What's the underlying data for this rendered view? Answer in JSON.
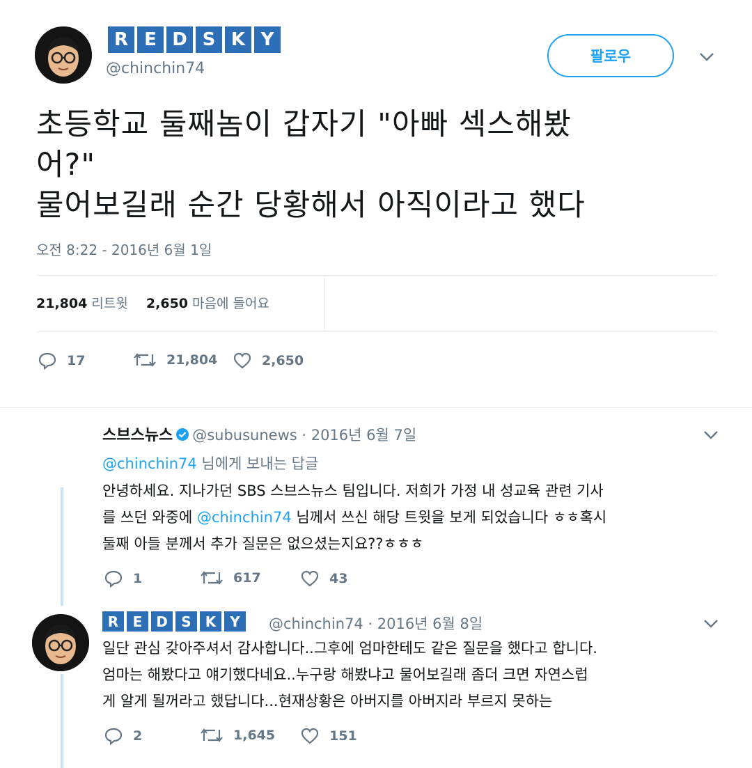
{
  "main_tweet": {
    "display_name_badges": [
      "R",
      "E",
      "D",
      "S",
      "K",
      "Y"
    ],
    "handle": "@chinchin74",
    "follow_label": "팔로우",
    "text_lines": [
      "초등학교 둘째놈이 갑자기  \"아빠  섹스해봤",
      "어?\"",
      "물어보길래 순간 당황해서  아직이라고 했다"
    ],
    "timestamp": "오전 8:22 - 2016년 6월 1일",
    "retweet_count": "21,804",
    "retweet_label": "리트윗",
    "like_count": "2,650",
    "like_label": "마음에 들어요",
    "actions": {
      "reply": "17",
      "retweet": "21,804",
      "like": "2,650"
    }
  },
  "reply_1": {
    "name": "스브스뉴스",
    "handle_date": "@subusunews · 2016년 6월 7일",
    "reply_to_handle": "@chinchin74",
    "reply_to_suffix": " 님에게 보내는 답글",
    "line1": "안녕하세요. 지나가던 SBS 스브스뉴스 팀입니다. 저희가 가정 내 성교육 관련 기사",
    "line2_pre": "를 쓰던 와중에 ",
    "line2_mention": "@chinchin74",
    "line2_post": " 님께서 쓰신 해당 트윗을 보게 되었습니다 ㅎㅎ혹시",
    "line3": "둘째 아들 분께서 추가 질문은 없으셨는지요??ㅎㅎㅎ",
    "actions": {
      "reply": "1",
      "retweet": "617",
      "like": "43"
    }
  },
  "reply_2": {
    "display_name_badges": [
      "R",
      "E",
      "D",
      "S",
      "K",
      "Y"
    ],
    "handle_date": "@chinchin74 · 2016년 6월 8일",
    "lines": [
      "일단 관심 갖아주셔서 감사합니다..그후에 엄마한테도 같은 질문을 했다고 합니다.",
      "엄마는 해봤다고 얘기했다네요..누구랑 해봤냐고 물어보길래 좀더 크면 자연스럽",
      "게 알게 될꺼라고 했답니다...현재상황은 아버지를 아버지라 부르지 못하는"
    ],
    "actions": {
      "reply": "2",
      "retweet": "1,645",
      "like": "151"
    }
  },
  "colors": {
    "accent": "#1da1f2",
    "badge": "#2d6fb6",
    "muted_text": "#657786",
    "thread_line": "#c5e4f8"
  }
}
